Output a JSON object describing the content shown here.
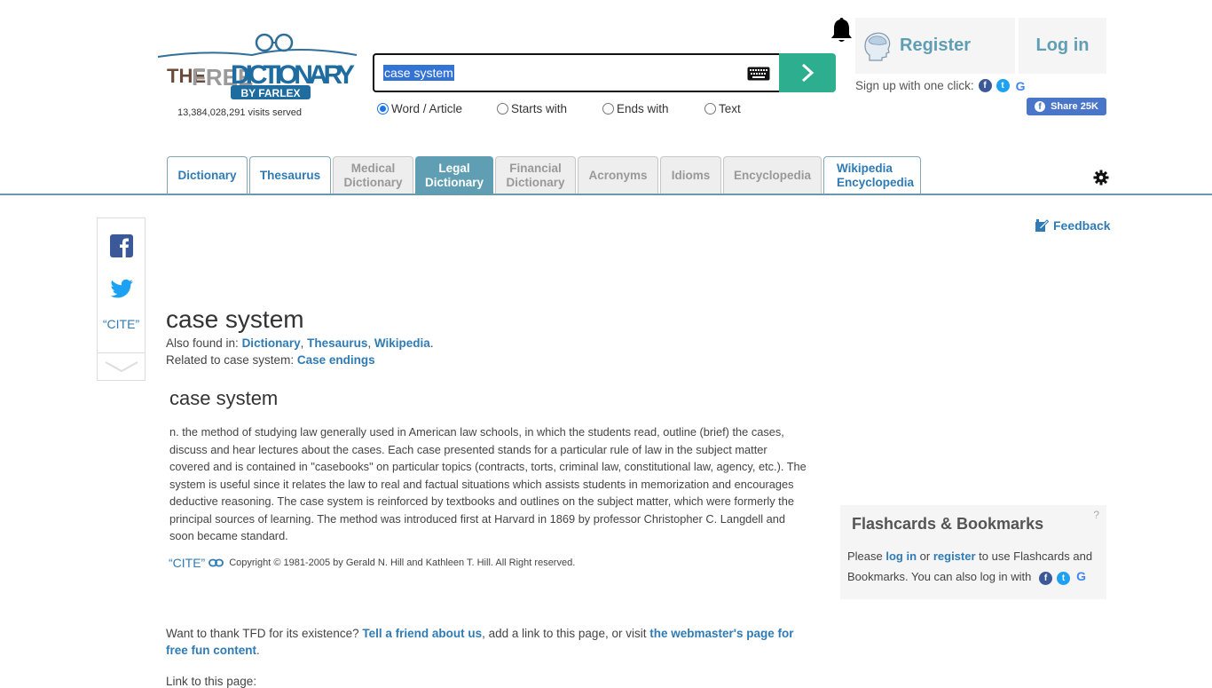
{
  "header": {
    "logo_text": {
      "the": "THE",
      "free": "FREE",
      "dictionary": "DICTIONARY",
      "by": "BY FARLEX"
    },
    "visits": "13,384,028,291 visits served",
    "search": {
      "value": "case system",
      "button_icon": "chevron-right-icon",
      "keyboard_icon": "keyboard-icon"
    },
    "search_modes": [
      {
        "label": "Word / Article",
        "checked": true
      },
      {
        "label": "Starts with",
        "checked": false
      },
      {
        "label": "Ends with",
        "checked": false
      },
      {
        "label": "Text",
        "checked": false
      }
    ],
    "register_label": "Register",
    "login_label": "Log in",
    "signup_text": "Sign up with one click:",
    "share_label": "Share 25K"
  },
  "tabs": [
    {
      "label": "Dictionary",
      "style": "blue"
    },
    {
      "label": "Thesaurus",
      "style": "blue"
    },
    {
      "label": "Medical Dictionary",
      "style": "gray"
    },
    {
      "label": "Legal Dictionary",
      "style": "active"
    },
    {
      "label": "Financial Dictionary",
      "style": "gray"
    },
    {
      "label": "Acronyms",
      "style": "gray"
    },
    {
      "label": "Idioms",
      "style": "gray"
    },
    {
      "label": "Encyclopedia",
      "style": "gray"
    },
    {
      "label": "Wikipedia Encyclopedia",
      "style": "blue"
    }
  ],
  "sidebar": {
    "cite_label": "“CITE”"
  },
  "feedback_label": "Feedback",
  "entry": {
    "title": "case system",
    "also_found_prefix": "Also found in: ",
    "also_found": [
      "Dictionary",
      "Thesaurus",
      "Wikipedia"
    ],
    "related_prefix": "Related to case system: ",
    "related_link": "Case endings",
    "headword": "case system",
    "definition": "n. the method of studying law generally used in American law schools, in which the students read, outline (brief) the cases, discuss and hear lectures about the cases. Each case presented stands for a particular rule of law in the subject matter covered and is contained in \"casebooks\" on particular topics (contracts, torts, criminal law, constitutional law, agency, etc.). The system is useful since it relates the law to real and factual situations which assists students in memorization and encourages deductive reasoning. The case system is reinforced by textbooks and outlines on the subject matter, which were formerly the principal sources of learning. The method was introduced first at Harvard in 1869 by professor Christopher C. Langdell and soon became standard.",
    "cite_label": "“CITE”",
    "copyright": "Copyright © 1981-2005 by Gerald N. Hill and Kathleen T. Hill. All Right reserved."
  },
  "flashcards": {
    "title": "Flashcards & Bookmarks",
    "help": "?",
    "text_1": "Please ",
    "login_link": "log in",
    "text_2": " or ",
    "register_link": "register",
    "text_3": " to use Flashcards and Bookmarks. You can also log in with"
  },
  "footer": {
    "thanks_1": "Want to thank TFD for its existence? ",
    "tell_friend": "Tell a friend about us",
    "thanks_2": ", add a link to this page, or visit ",
    "webmaster": "the webmaster's page for free fun content",
    "thanks_3": ".",
    "link_to": "Link to this page:"
  },
  "colors": {
    "accent": "#2f7bb4",
    "tab_active": "#5f9eb3",
    "search_button": "#2cae8f"
  }
}
